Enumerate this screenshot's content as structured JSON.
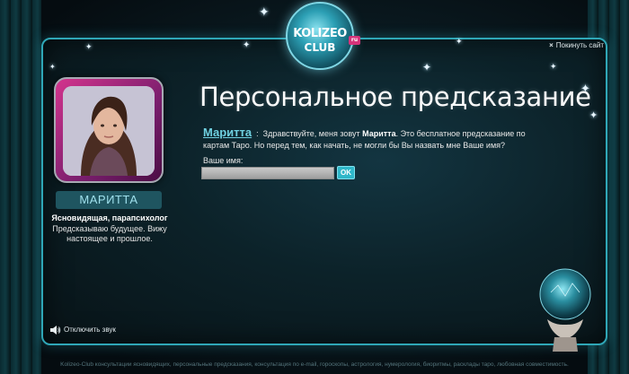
{
  "logo": {
    "top_text": "KOLIZEO",
    "bottom_text": "CLUB",
    "badge": "ru"
  },
  "header": {
    "leave_site_label": "Покинуть сайт"
  },
  "psychic": {
    "name": "МАРИТТА",
    "role": "Ясновидящая, парапсихолог",
    "tagline": "Предсказываю будущее. Вижу настоящее и прошлое."
  },
  "main": {
    "title": "Персональное предсказание",
    "speaker": "Маритта",
    "message_part1": "Здравствуйте, меня зовут",
    "message_name": "Маритта",
    "message_part2": ". Это бесплатное предсказание по картам Таро. Но перед тем, как начать, не могли бы Вы назвать мне Ваше имя?",
    "field_label": "Ваше имя:",
    "input_value": "",
    "ok_label": "OK"
  },
  "sound": {
    "mute_label": "Отключить звук"
  },
  "footer": {
    "text": "Kolizeo-Club консультации ясновидящих, персональные предсказания, консультация по e-mail, гороскопы, астрология, нумерология, биоритмы, расклады таро, любовная совместимость."
  },
  "colors": {
    "accent": "#2fa7b7",
    "speaker_link": "#6fd0e0",
    "avatar_frame": "#d3348d"
  }
}
